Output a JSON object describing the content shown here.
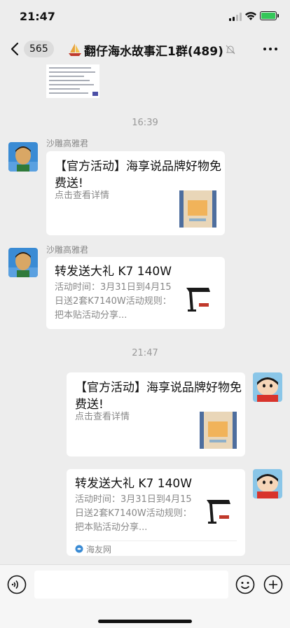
{
  "status_bar": {
    "time": "21:47"
  },
  "nav": {
    "unread_count": "565",
    "title": "翻仔海水故事汇1群(489)"
  },
  "messages": [
    {
      "type": "timestamp",
      "text": "16:39"
    },
    {
      "type": "card",
      "side": "left",
      "sender": "沙雕高雅君",
      "title": "【官方活动】海享说品牌好物免费送!",
      "desc": "点击查看详情"
    },
    {
      "type": "card",
      "side": "left",
      "sender": "沙雕高雅君",
      "title": "转发送大礼 K7 140W",
      "desc": "活动时间：3月31日到4月15日送2套K7140W活动规则：把本贴活动分享..."
    },
    {
      "type": "timestamp",
      "text": "21:47"
    },
    {
      "type": "card",
      "side": "right",
      "title": "【官方活动】海享说品牌好物免费送!",
      "desc": "点击查看详情"
    },
    {
      "type": "card",
      "side": "right",
      "title": "转发送大礼 K7 140W",
      "desc": "活动时间：3月31日到4月15日送2套K7140W活动规则：把本贴活动分享...",
      "source": "海友网"
    }
  ],
  "colors": {
    "background": "#ededed",
    "card": "#ffffff",
    "battery": "#34c759"
  },
  "icons": [
    "signal-icon",
    "wifi-icon",
    "battery-icon",
    "back-arrow-icon",
    "sailboat-icon",
    "mute-icon",
    "more-icon",
    "voice-icon",
    "emoji-icon",
    "plus-icon"
  ]
}
